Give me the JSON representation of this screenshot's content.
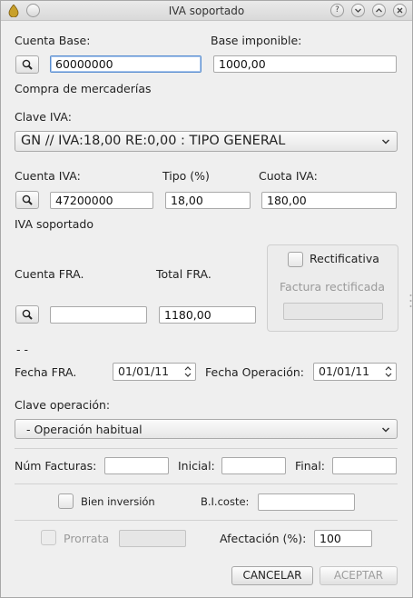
{
  "window": {
    "title": "IVA soportado",
    "controls": {
      "help": "?",
      "minimize": "v",
      "maximize": "^",
      "close": "x"
    }
  },
  "cuenta_base": {
    "label": "Cuenta Base:",
    "value": "60000000",
    "description": "Compra de mercaderías"
  },
  "base_imponible": {
    "label": "Base imponible:",
    "value": "1000,00"
  },
  "clave_iva": {
    "label": "Clave IVA:",
    "selected": "GN // IVA:18,00 RE:0,00 : TIPO GENERAL"
  },
  "cuenta_iva": {
    "label": "Cuenta IVA:",
    "value": "47200000",
    "description": "IVA soportado"
  },
  "tipo": {
    "label": "Tipo (%)",
    "value": "18,00"
  },
  "cuota_iva": {
    "label": "Cuota IVA:",
    "value": "180,00"
  },
  "cuenta_fra": {
    "label": "Cuenta FRA.",
    "value": "",
    "description": "- -"
  },
  "total_fra": {
    "label": "Total FRA.",
    "value": "1180,00"
  },
  "rectificativa": {
    "label": "Rectificativa",
    "checked": false,
    "factura_label": "Factura rectificada",
    "factura_value": ""
  },
  "fecha_fra": {
    "label": "Fecha FRA.",
    "value": "01/01/11"
  },
  "fecha_operacion": {
    "label": "Fecha Operación:",
    "value": "01/01/11"
  },
  "clave_operacion": {
    "label": "Clave operación:",
    "selected": "- Operación habitual"
  },
  "num_facturas": {
    "label": "Núm Facturas:",
    "value": ""
  },
  "inicial": {
    "label": "Inicial:",
    "value": ""
  },
  "final": {
    "label": "Final:",
    "value": ""
  },
  "bien_inversion": {
    "label": "Bien inversión",
    "checked": false
  },
  "bi_coste": {
    "label": "B.I.coste:",
    "value": ""
  },
  "prorrata": {
    "label": "Prorrata",
    "checked": false,
    "value": ""
  },
  "afectacion": {
    "label": "Afectación (%):",
    "value": "100"
  },
  "buttons": {
    "cancel": "CANCELAR",
    "accept": "ACEPTAR"
  }
}
